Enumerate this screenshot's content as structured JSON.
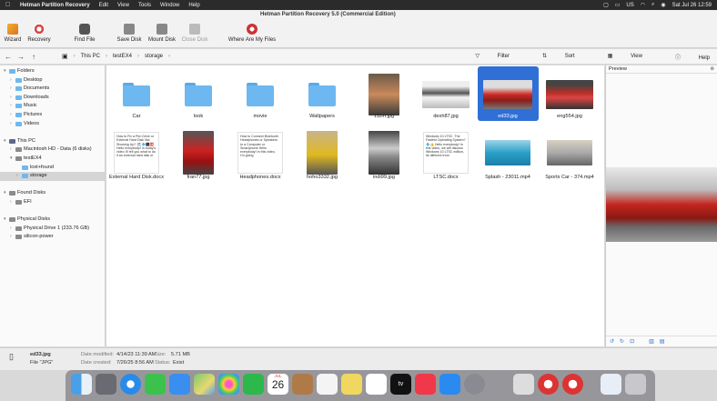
{
  "menubar": {
    "app": "Hetman Partition Recovery",
    "items": [
      "Edit",
      "View",
      "Tools",
      "Window",
      "Help"
    ],
    "window_title": "Hetman Partition Recovery 5.0 (Commercial Edition)",
    "lang": "US",
    "datetime": "Sat Jul 26  12:59"
  },
  "toolbar": {
    "wizard": "Wizard",
    "recovery": "Recovery",
    "find_file": "Find File",
    "save_disk": "Save Disk",
    "mount_disk": "Mount Disk",
    "close_disk": "Close Disk",
    "where_files": "Where Are My Files"
  },
  "nav": {
    "crumbs": [
      "This PC",
      "testEX4",
      "storage"
    ],
    "filter": "Filter",
    "sort": "Sort",
    "view": "View",
    "help": "Help"
  },
  "tree": {
    "folders": "Folders",
    "desktop": "Desktop",
    "documents": "Documents",
    "downloads": "Downloads",
    "music": "Music",
    "pictures": "Pictures",
    "videos": "Videos",
    "this_pc": "This PC",
    "macintosh": "Macintosh HD - Data (6 disks)",
    "testex4": "testEX4",
    "lost_found": "lost+found",
    "storage": "storage",
    "found_disks": "Found Disks",
    "efi": "EFI",
    "physical_disks": "Physical Disks",
    "drive1": "Physical Drive 1 (233.76 GB)",
    "silicon": "silicon-power"
  },
  "files": [
    {
      "name": "Car",
      "kind": "folder"
    },
    {
      "name": "look",
      "kind": "folder"
    },
    {
      "name": "movie",
      "kind": "folder"
    },
    {
      "name": "Wallpapers",
      "kind": "folder"
    },
    {
      "name": "111m.jpg",
      "kind": "photo"
    },
    {
      "name": "dexh87.jpg",
      "kind": "photo"
    },
    {
      "name": "ed33.jpg",
      "kind": "photo"
    },
    {
      "name": "eng554.jpg",
      "kind": "photo"
    },
    {
      "name": "External Hard Disk.docx",
      "kind": "doc"
    },
    {
      "name": "fran77.jpg",
      "kind": "photo"
    },
    {
      "name": "Headphones.docx",
      "kind": "doc"
    },
    {
      "name": "hoho3332.jpg",
      "kind": "photo"
    },
    {
      "name": "indi99.jpg",
      "kind": "photo"
    },
    {
      "name": "LTSC.docx",
      "kind": "doc"
    },
    {
      "name": "Splash - 23011.mp4",
      "kind": "video"
    },
    {
      "name": "Sports Car - 374.mp4",
      "kind": "video"
    }
  ],
  "docs": {
    "ext_hdd": "How to Fix a Pen Drive or External Hard Disk Not Showing Up? 🛠 💠⬛🆎 Hello everybody! In today's video I'll tell you what to do if an external hard disk or",
    "headphones": "How to Connect Bluetooth Headphones or Speakers to a Computer or Smartphone Hello everybody! In this video, I'm going",
    "ltsc": "Windows 10 LTSC. The Fastest Operating System? 💠👍 Hello everybody! In this video, we will discuss Windows 10 LTSC edition, its different from"
  },
  "preview": {
    "title": "Preview"
  },
  "status": {
    "file_name": "ed33.jpg",
    "file_type": "File \"JPG\"",
    "modified_label": "Date modified:",
    "modified": "4/14/23 11:39 AM",
    "created_label": "Date created:",
    "created": "7/26/25 8:56 AM",
    "size_label": "Size:",
    "size": "5.71 MB",
    "status_label": "Status:",
    "status": "Exist"
  },
  "dock": {
    "calendar_month": "JUL",
    "calendar_day": "26"
  },
  "colors": {
    "accent": "#2f6fd6",
    "folder": "#6db8f0"
  }
}
